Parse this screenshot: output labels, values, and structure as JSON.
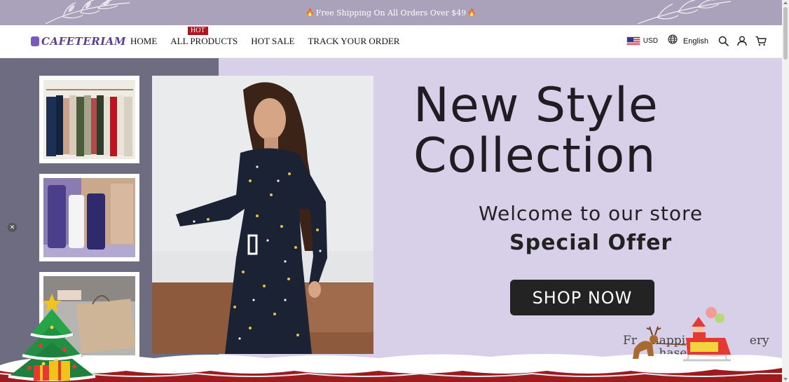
{
  "announcement": {
    "text": "Free Shipping On All Orders Over $49",
    "icon": "flame-icon"
  },
  "header": {
    "logo": "CAFETERIAM",
    "nav": [
      "HOME",
      "ALL PRODUCTS",
      "HOT SALE",
      "TRACK YOUR ORDER"
    ],
    "hot_badge": "HOT",
    "currency": "USD",
    "language": "English",
    "icons": [
      "globe-icon",
      "search-icon",
      "user-icon",
      "cart-icon"
    ]
  },
  "hero": {
    "title_line1": "New Style",
    "title_line2": "Collection",
    "welcome": "Welcome to our store",
    "special": "Special Offer",
    "cta": "SHOP NOW",
    "footer_msg_left": "Fr",
    "footer_msg_mid": "happin",
    "footer_msg_right": "ery",
    "footer_msg_line2": "hase"
  },
  "colors": {
    "announce_bg": "#a9a2ba",
    "hero_left_bg": "#6e6c80",
    "hero_right_bg": "#d8cfe9",
    "button_bg": "#232323",
    "ribbon": "#9c1b1f"
  }
}
